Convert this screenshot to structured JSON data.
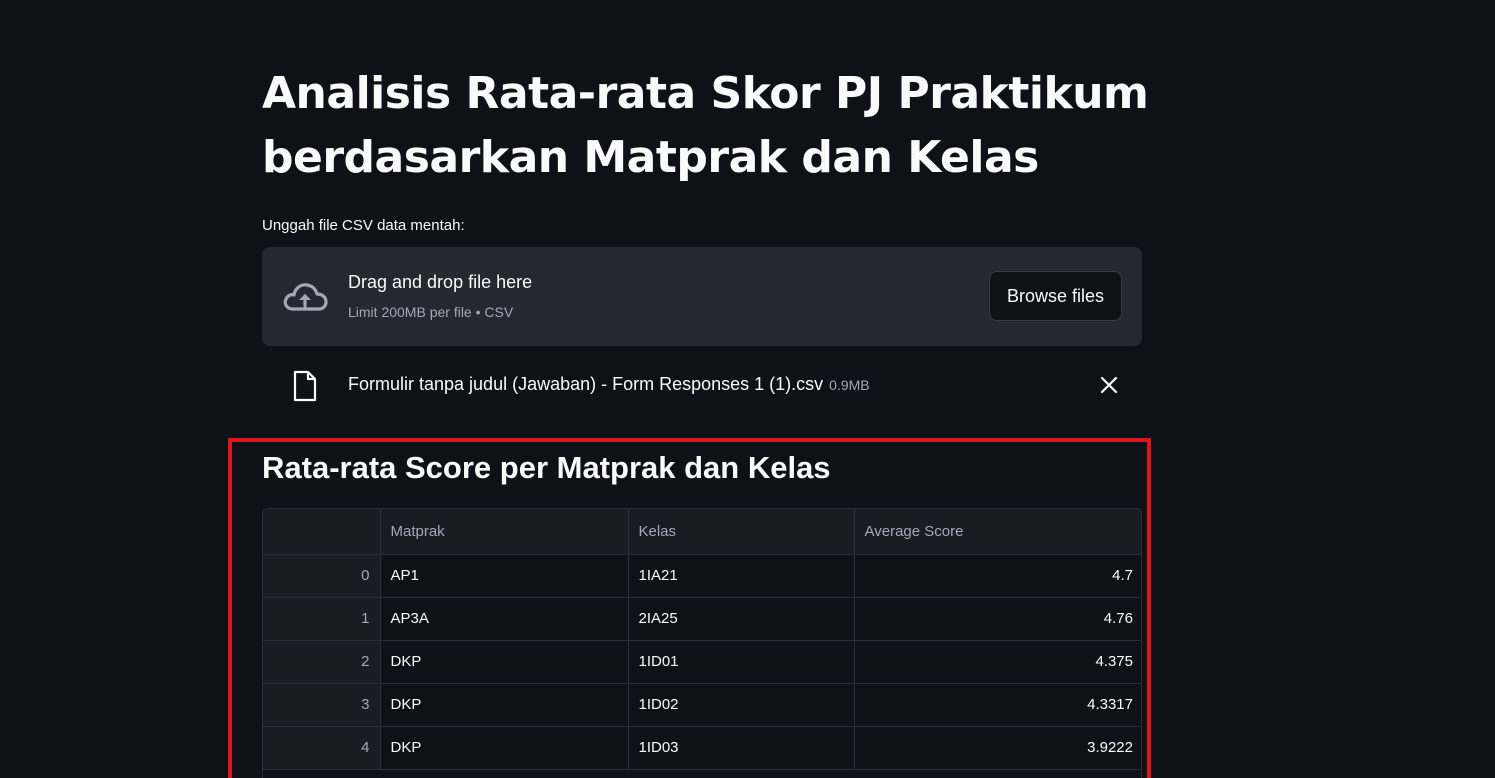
{
  "page": {
    "title_line1": "Analisis Rata-rata Skor PJ Praktikum",
    "title_line2": "berdasarkan Matprak dan Kelas"
  },
  "uploader": {
    "label": "Unggah file CSV data mentah:",
    "drop_text": "Drag and drop file here",
    "limit_text": "Limit 200MB per file • CSV",
    "browse_label": "Browse files",
    "icon": "cloud-upload-icon"
  },
  "uploaded_file": {
    "name": "Formulir tanpa judul (Jawaban) - Form Responses 1 (1).csv",
    "size": "0.9MB",
    "icon": "file-icon",
    "remove_icon": "close-icon"
  },
  "section": {
    "title": "Rata-rata Score per Matprak dan Kelas"
  },
  "table": {
    "columns": [
      "",
      "Matprak",
      "Kelas",
      "Average Score"
    ],
    "rows": [
      {
        "index": "0",
        "matprak": "AP1",
        "kelas": "1IA21",
        "score": "4.7"
      },
      {
        "index": "1",
        "matprak": "AP3A",
        "kelas": "2IA25",
        "score": "4.76"
      },
      {
        "index": "2",
        "matprak": "DKP",
        "kelas": "1ID01",
        "score": "4.375"
      },
      {
        "index": "3",
        "matprak": "DKP",
        "kelas": "1ID02",
        "score": "4.3317"
      },
      {
        "index": "4",
        "matprak": "DKP",
        "kelas": "1ID03",
        "score": "3.9222"
      }
    ]
  },
  "colors": {
    "background": "#0e1117",
    "panel": "#262730",
    "highlight_border": "#d7191c"
  }
}
